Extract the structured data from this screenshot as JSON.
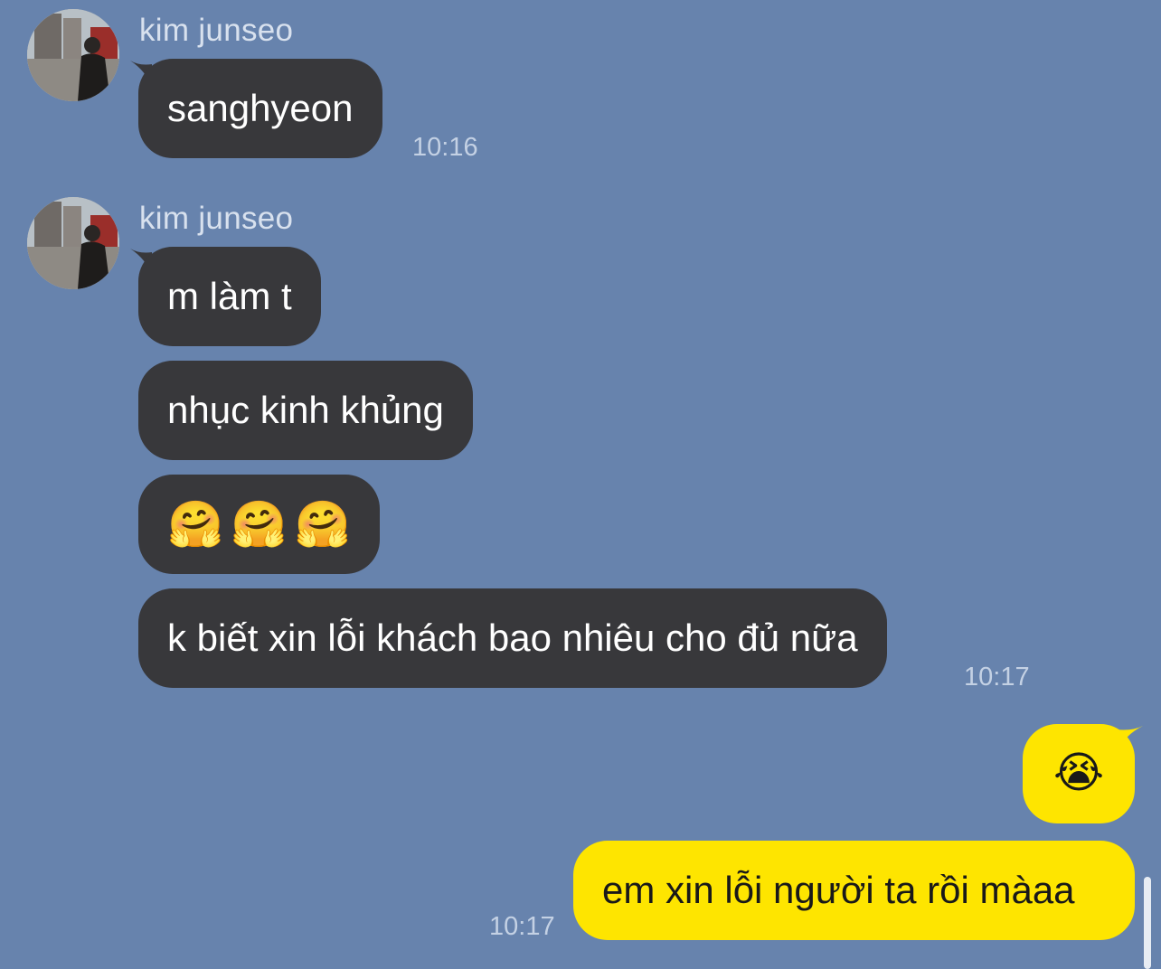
{
  "messages": [
    {
      "sender": "kim junseo",
      "text": "sanghyeon",
      "time": "10:16"
    },
    {
      "sender": "kim junseo",
      "lines": [
        "m làm t",
        "nhục kinh khủng",
        "🤗🤗🤗",
        "k biết xin lỗi khách bao nhiêu cho đủ nữa"
      ],
      "time": "10:17"
    }
  ],
  "emoji_hug": "🤗",
  "outgoing": {
    "bubble1": "😭",
    "bubble2": "em xin lỗi người ta rồi màaa",
    "time": "10:17"
  },
  "colors": {
    "background": "#6783ad",
    "incoming_bubble": "#38383b",
    "outgoing_bubble": "#fee500"
  }
}
